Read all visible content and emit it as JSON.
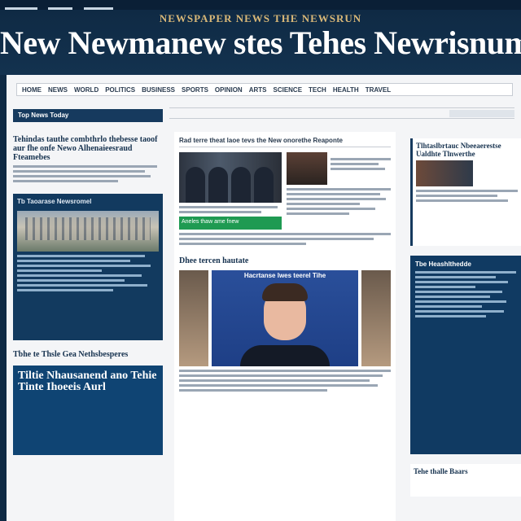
{
  "masthead": {
    "tagline": "NEWSPAPER NEWS THE NEWSRUN",
    "brand": "New Newmanew stes Tehes Newrisnum"
  },
  "nav": {
    "items": [
      "HOME",
      "NEWS",
      "WORLD",
      "POLITICS",
      "BUSINESS",
      "SPORTS",
      "OPINION",
      "ARTS",
      "SCIENCE",
      "TECH",
      "HEALTH",
      "TRAVEL"
    ]
  },
  "left": {
    "header": "Top News Today",
    "story_title": "Tehindas tauthe combthrlo thebesse taoof aur fhe onfe Newo Alhenaieesraud Fteamebes",
    "blue_caption": "Tb Taoarase Newsromel",
    "section_title": "Tbhe te Thsle Gea Nethsbesperes",
    "box_title": "Tiltie Nhausanend ano Tehie Tinte Ihoeeis Aurl"
  },
  "center": {
    "header": "Rad terre theat laoe tevs the New onorethe Reaponte",
    "green_bar": "Aneles thaw ame fnew",
    "section_title": "Dhee tercen hautate",
    "feature_banner": "Hacrtanse lwes teerel Tihe"
  },
  "right": {
    "card_title": "Tlhtaslbrtauc Nbeeaerestse Ualdhte Tlnwerthe",
    "blue_title": "Tbe Heashlthedde",
    "foot_title": "Tehe thalle Baars"
  },
  "colors": {
    "masthead_bg": "#0f2a44",
    "accent_blue": "#163a5e",
    "accent_green": "#1f9a52",
    "tagline_gold": "#d9b878"
  }
}
